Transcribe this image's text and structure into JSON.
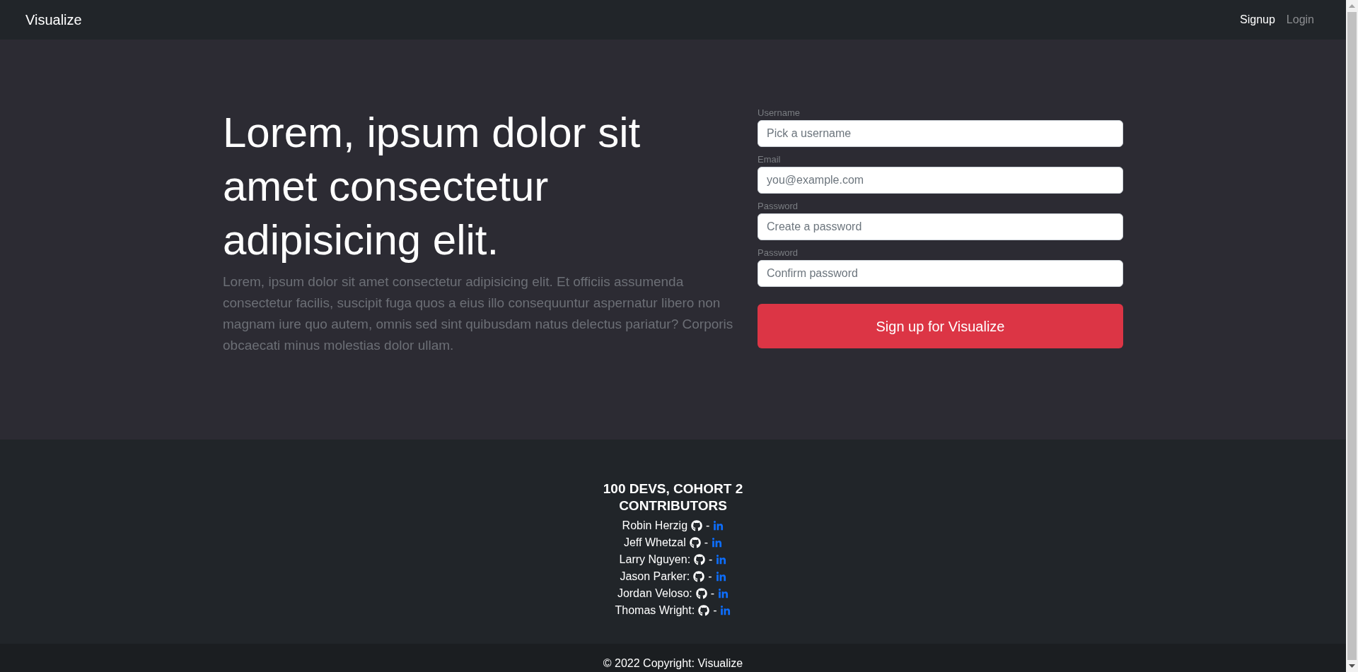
{
  "navbar": {
    "brand": "Visualize",
    "links": [
      {
        "label": "Signup",
        "selected": true
      },
      {
        "label": "Login",
        "selected": false
      }
    ]
  },
  "hero": {
    "heading": "Lorem, ipsum dolor sit amet consectetur adipisicing elit.",
    "lead": "Lorem, ipsum dolor sit amet consectetur adipisicing elit. Et officiis assumenda consectetur facilis, suscipit fuga quos a eius illo consequuntur aspernatur libero non magnam iure quo autem, omnis sed sint quibusdam natus delectus pariatur? Corporis obcaecati minus molestias dolor ullam."
  },
  "signup_form": {
    "fields": [
      {
        "label": "Username",
        "placeholder": "Pick a username"
      },
      {
        "label": "Email",
        "placeholder": "you@example.com"
      },
      {
        "label": "Password",
        "placeholder": "Create a password"
      },
      {
        "label": "Password",
        "placeholder": "Confirm password"
      }
    ],
    "submit": "Sign up for Visualize"
  },
  "footer": {
    "heading": "100 DEVS, COHORT 2 CONTRIBUTORS",
    "contributors": [
      {
        "name": "Robin Herzig",
        "separator": "-"
      },
      {
        "name": "Jeff Whetzal",
        "separator": "-"
      },
      {
        "name": "Larry Nguyen:",
        "separator": "-"
      },
      {
        "name": "Jason Parker:",
        "separator": "-"
      },
      {
        "name": "Jordan Veloso:",
        "separator": "-"
      },
      {
        "name": "Thomas Wright:",
        "separator": "-"
      }
    ]
  },
  "copyright": "© 2022 Copyright: Visualize"
}
